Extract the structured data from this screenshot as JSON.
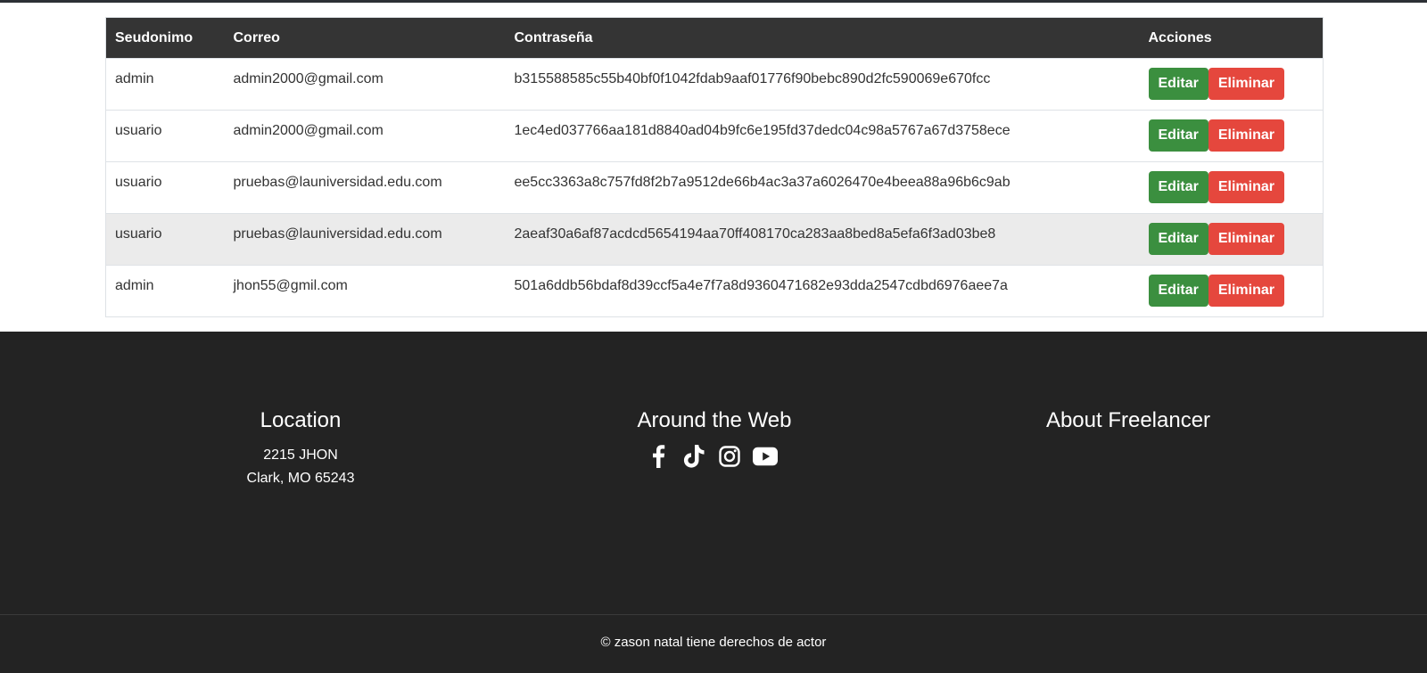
{
  "table": {
    "headers": [
      "Seudonimo",
      "Correo",
      "Contraseña",
      "Acciones"
    ],
    "rows": [
      {
        "seudonimo": "admin",
        "correo": "admin2000@gmail.com",
        "contrasena": "b315588585c55b40bf0f1042fdab9aaf01776f90bebc890d2fc590069e670fcc"
      },
      {
        "seudonimo": "usuario",
        "correo": "admin2000@gmail.com",
        "contrasena": "1ec4ed037766aa181d8840ad04b9fc6e195fd37dedc04c98a5767a67d3758ece"
      },
      {
        "seudonimo": "usuario",
        "correo": "pruebas@launiversidad.edu.com",
        "contrasena": "ee5cc3363a8c757fd8f2b7a9512de66b4ac3a37a6026470e4beea88a96b6c9ab"
      },
      {
        "seudonimo": "usuario",
        "correo": "pruebas@launiversidad.edu.com",
        "contrasena": "2aeaf30a6af87acdcd5654194aa70ff408170ca283aa8bed8a5efa6f3ad03be8"
      },
      {
        "seudonimo": "admin",
        "correo": "jhon55@gmil.com",
        "contrasena": "501a6ddb56bdaf8d39ccf5a4e7f7a8d9360471682e93dda2547cdbd6976aee7a"
      }
    ],
    "edit_label": "Editar",
    "delete_label": "Eliminar"
  },
  "footer": {
    "location": {
      "title": "Location",
      "line1": "2215 JHON",
      "line2": "Clark, MO 65243"
    },
    "web": {
      "title": "Around the Web",
      "icons": [
        "facebook-icon",
        "tiktok-icon",
        "instagram-icon",
        "youtube-icon"
      ]
    },
    "about": {
      "title": "About Freelancer"
    },
    "copyright": "© zason natal tiene derechos de actor"
  },
  "colors": {
    "header_bg": "#343434",
    "edit_button": "#3b8f3f",
    "delete_button": "#e5473d",
    "footer_bg": "#232323",
    "highlight_row": "#ebebeb"
  }
}
